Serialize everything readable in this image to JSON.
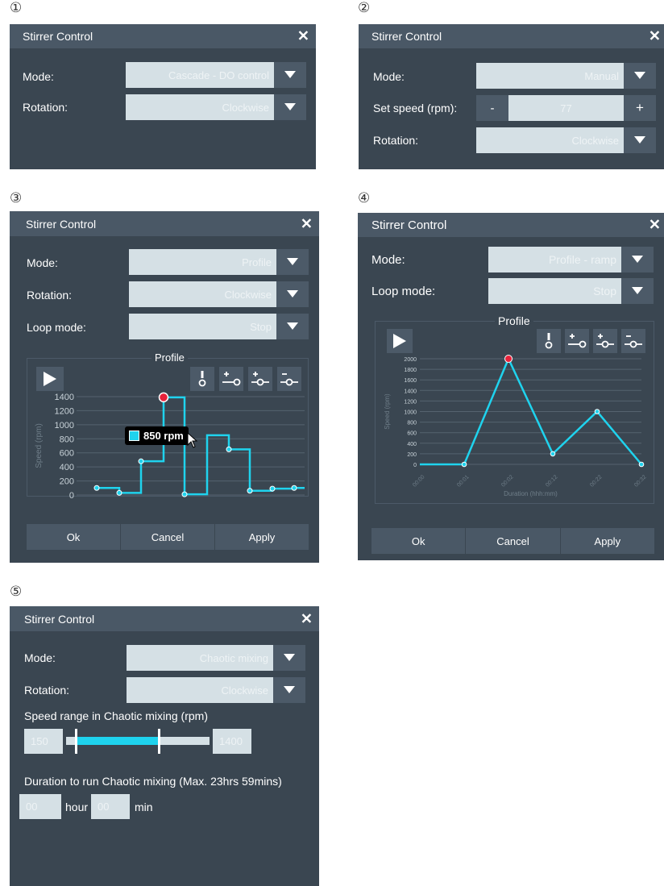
{
  "numbers": [
    "①",
    "②",
    "③",
    "④",
    "⑤"
  ],
  "colors": {
    "panel_bg": "#3a4651",
    "title_bg": "#4a5866",
    "field_bg": "#d5e0e5",
    "accent": "#1fd3ee",
    "marker": "#e8213a"
  },
  "panel1": {
    "title": "Stirrer Control",
    "close": "✕",
    "mode_label": "Mode:",
    "mode_value": "Cascade - DO control",
    "rotation_label": "Rotation:",
    "rotation_value": "Clockwise"
  },
  "panel2": {
    "title": "Stirrer Control",
    "close": "✕",
    "mode_label": "Mode:",
    "mode_value": "Manual",
    "speed_label": "Set speed (rpm):",
    "speed_minus": "-",
    "speed_value": "77",
    "speed_plus": "+",
    "rotation_label": "Rotation:",
    "rotation_value": "Clockwise"
  },
  "panel3": {
    "title": "Stirrer Control",
    "close": "✕",
    "mode_label": "Mode:",
    "mode_value": "Profile",
    "rotation_label": "Rotation:",
    "rotation_value": "Clockwise",
    "loop_label": "Loop mode:",
    "loop_value": "Stop",
    "profile_title": "Profile",
    "tooltip": "850 rpm",
    "ok": "Ok",
    "cancel": "Cancel",
    "apply": "Apply"
  },
  "panel4": {
    "title": "Stirrer Control",
    "close": "✕",
    "mode_label": "Mode:",
    "mode_value": "Profile - ramp",
    "loop_label": "Loop mode:",
    "loop_value": "Stop",
    "profile_title": "Profile",
    "ok": "Ok",
    "cancel": "Cancel",
    "apply": "Apply"
  },
  "panel5": {
    "title": "Stirrer Control",
    "close": "✕",
    "mode_label": "Mode:",
    "mode_value": "Chaotic mixing",
    "rotation_label": "Rotation:",
    "rotation_value": "Clockwise",
    "range_label": "Speed range in Chaotic mixing (rpm)",
    "range_min": "150",
    "range_max": "1400",
    "range_low_fraction": 0.0,
    "range_high_fraction": 0.62,
    "duration_label": "Duration to run Chaotic mixing (Max. 23hrs 59mins)",
    "hour_value": "00",
    "hour_label": "hour",
    "min_value": "00",
    "min_label": "min"
  },
  "chart_data": [
    {
      "type": "line",
      "step": true,
      "ylabel": "Speed (rpm)",
      "ylim": [
        0,
        1400
      ],
      "yticks": [
        "0",
        "200",
        "400",
        "600",
        "800",
        "1000",
        "1200",
        "1400"
      ],
      "points": [
        [
          0,
          100
        ],
        [
          1,
          100
        ],
        [
          1,
          30
        ],
        [
          2,
          30
        ],
        [
          2,
          480
        ],
        [
          3,
          480
        ],
        [
          3,
          1390
        ],
        [
          4,
          1390
        ],
        [
          4,
          10
        ],
        [
          5,
          10
        ],
        [
          5,
          850
        ],
        [
          6,
          850
        ],
        [
          6,
          650
        ],
        [
          7,
          650
        ],
        [
          7,
          60
        ],
        [
          8,
          60
        ],
        [
          8,
          90
        ],
        [
          9,
          90
        ],
        [
          9,
          100
        ],
        [
          10,
          100
        ]
      ],
      "markers": [
        [
          0,
          100
        ],
        [
          1,
          30
        ],
        [
          2,
          480
        ],
        [
          3,
          1390
        ],
        [
          4,
          10
        ],
        [
          6,
          650
        ],
        [
          7,
          60
        ],
        [
          8,
          90
        ],
        [
          9,
          100
        ]
      ],
      "highlight": [
        3,
        1390
      ]
    },
    {
      "type": "line",
      "ylabel": "Speed (rpm)",
      "xlabel": "Duration (hhh:mm)",
      "ylim": [
        0,
        2000
      ],
      "yticks": [
        "0",
        "200",
        "400",
        "600",
        "800",
        "1000",
        "1200",
        "1400",
        "1600",
        "1800",
        "2000"
      ],
      "xticks": [
        "00:00",
        "00:01",
        "00:02",
        "00:12",
        "00:22",
        "00:32"
      ],
      "points": [
        [
          0,
          0
        ],
        [
          1,
          0
        ],
        [
          2,
          2000
        ],
        [
          3,
          200
        ],
        [
          4,
          1000
        ],
        [
          5,
          0
        ]
      ],
      "highlight": [
        2,
        2000
      ]
    }
  ]
}
